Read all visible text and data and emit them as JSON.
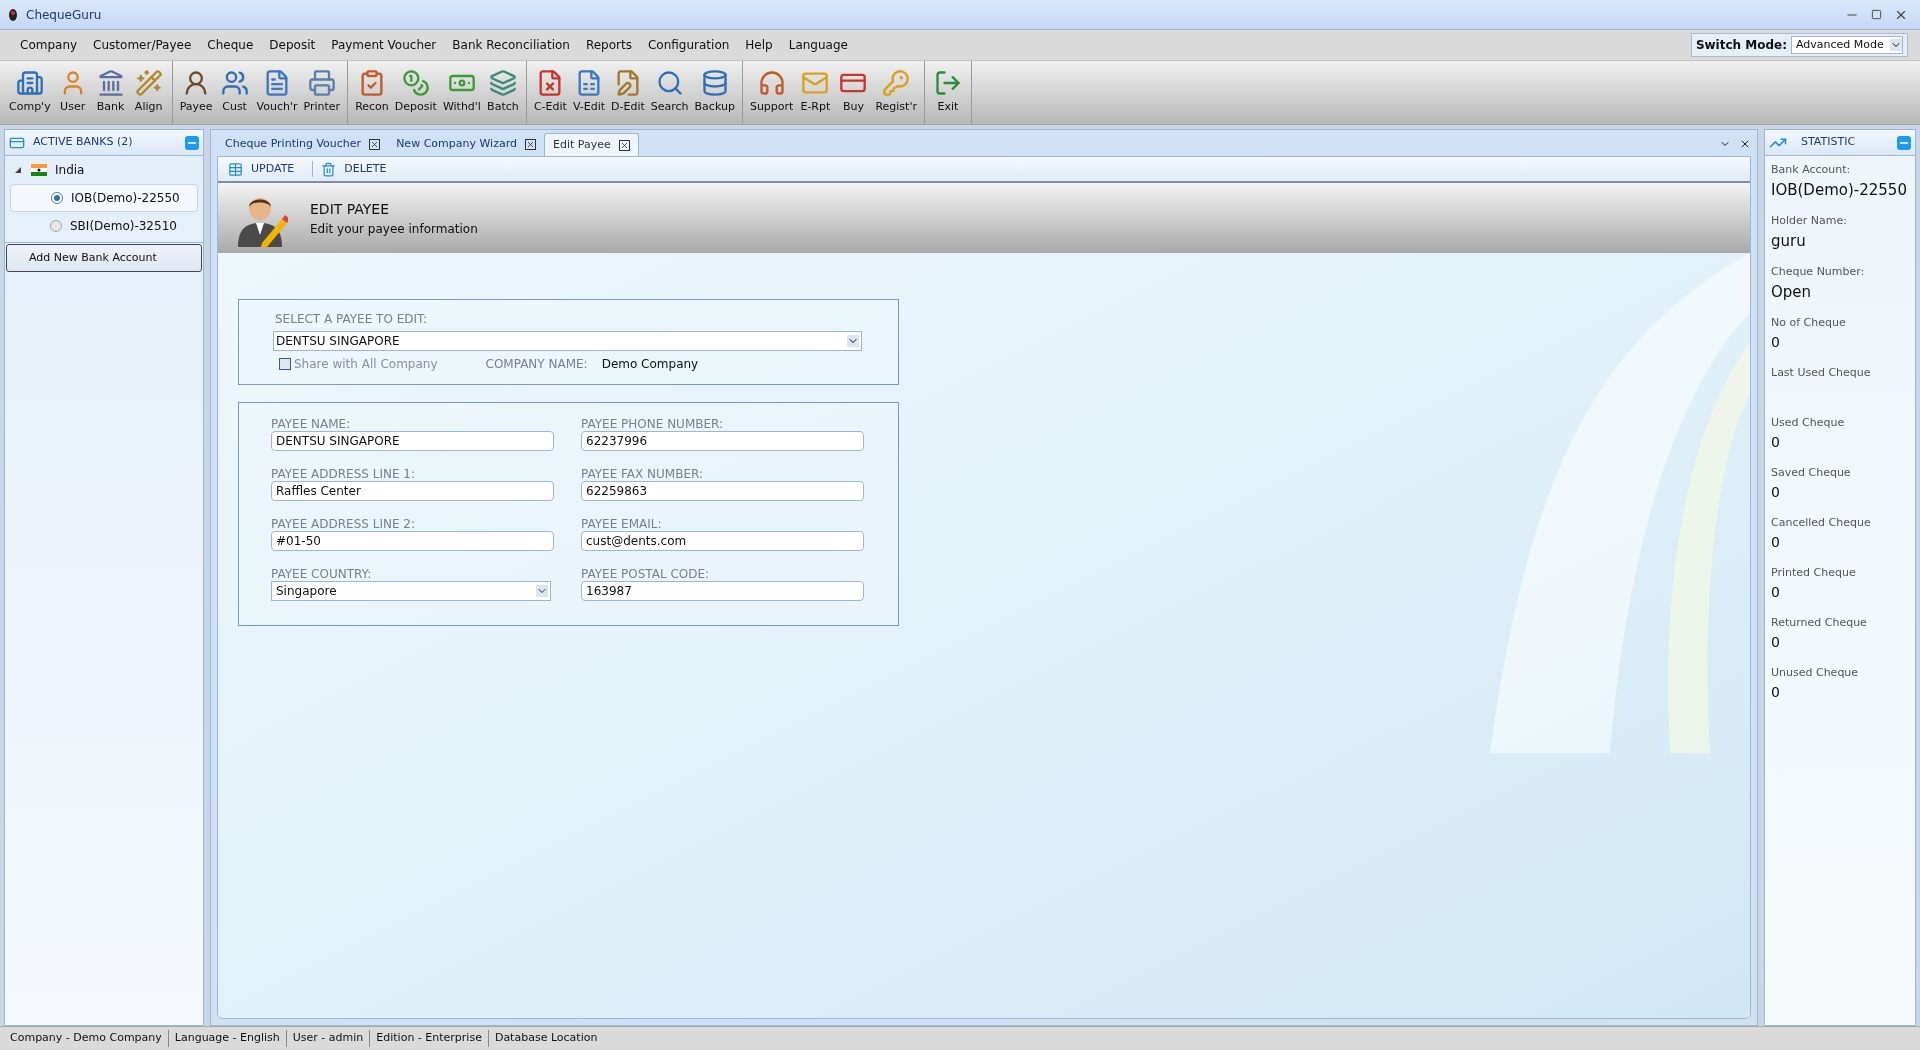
{
  "window": {
    "title": "ChequeGuru"
  },
  "menu": [
    "Company",
    "Customer/Payee",
    "Cheque",
    "Deposit",
    "Payment Voucher",
    "Bank Reconciliation",
    "Reports",
    "Configuration",
    "Help",
    "Language"
  ],
  "switch_mode": {
    "label": "Switch Mode:",
    "value": "Advanced Mode"
  },
  "toolbar": [
    [
      "Comp'y",
      "User",
      "Bank",
      "Align"
    ],
    [
      "Payee",
      "Cust",
      "Vouch'r",
      "Printer"
    ],
    [
      "Recon",
      "Deposit",
      "Withd'l",
      "Batch"
    ],
    [
      "C-Edit",
      "V-Edit",
      "D-Edit",
      "Search",
      "Backup"
    ],
    [
      "Support",
      "E-Rpt",
      "Buy",
      "Regist'r"
    ],
    [
      "Exit"
    ]
  ],
  "active_banks": {
    "title": "ACTIVE BANKS (2)",
    "tree": [
      {
        "label": "India",
        "expanded": true,
        "children": [
          {
            "label": "IOB(Demo)-22550",
            "selected": true
          },
          {
            "label": "SBI(Demo)-32510",
            "selected": false
          }
        ]
      }
    ],
    "add_button": "Add New Bank Account"
  },
  "tabs": [
    {
      "label": "Cheque Printing Voucher",
      "selected": false
    },
    {
      "label": "New Company Wizard",
      "selected": false
    },
    {
      "label": "Edit Payee",
      "selected": true
    }
  ],
  "actions": [
    "UPDATE",
    "DELETE"
  ],
  "header": {
    "title": "EDIT PAYEE",
    "subtitle": "Edit your payee information"
  },
  "select_payee": {
    "label": "SELECT A PAYEE TO EDIT:",
    "value": "DENTSU SINGAPORE",
    "share": {
      "label": "Share with All Company",
      "checked": false
    },
    "company_label": "COMPANY NAME:",
    "company_value": "Demo Company"
  },
  "fields": [
    {
      "kind": "text",
      "label": "PAYEE NAME:",
      "value": "DENTSU SINGAPORE"
    },
    {
      "kind": "text",
      "label": "PAYEE PHONE NUMBER:",
      "value": "62237996"
    },
    {
      "kind": "text",
      "label": "PAYEE ADDRESS LINE 1:",
      "value": "Raffles Center"
    },
    {
      "kind": "text",
      "label": "PAYEE FAX NUMBER:",
      "value": "62259863"
    },
    {
      "kind": "text",
      "label": "PAYEE ADDRESS LINE 2:",
      "value": "#01-50"
    },
    {
      "kind": "text",
      "label": "PAYEE EMAIL:",
      "value": "cust@dents.com"
    },
    {
      "kind": "select",
      "label": "PAYEE COUNTRY:",
      "value": "Singapore"
    },
    {
      "kind": "text",
      "label": "PAYEE POSTAL CODE:",
      "value": "163987"
    }
  ],
  "statistic": {
    "title": "STATISTIC",
    "items": [
      {
        "label": "Bank Account:",
        "value": "IOB(Demo)-22550"
      },
      {
        "label": "Holder Name:",
        "value": "guru"
      },
      {
        "label": "Cheque Number:",
        "value": "Open"
      },
      {
        "label": "No of Cheque",
        "value": "0"
      },
      {
        "label": "Last Used Cheque"
      },
      {
        "label": "Used Cheque",
        "value": "0"
      },
      {
        "label": "Saved Cheque",
        "value": "0"
      },
      {
        "label": "Cancelled Cheque",
        "value": "0"
      },
      {
        "label": "Printed Cheque",
        "value": "0"
      },
      {
        "label": "Returned Cheque",
        "value": "0"
      },
      {
        "label": "Unused Cheque",
        "value": "0"
      }
    ]
  },
  "status_bar": [
    "Company - Demo Company",
    "Language - English",
    "User - admin",
    "Edition - Enterprise",
    "Database Location"
  ]
}
